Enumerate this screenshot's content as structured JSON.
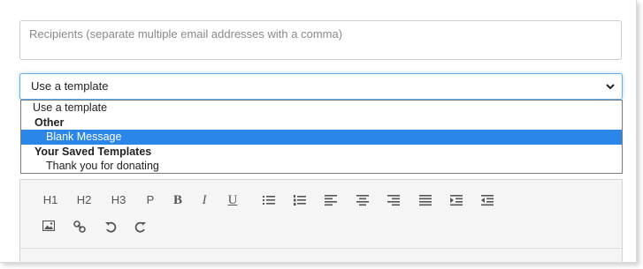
{
  "recipients": {
    "placeholder": "Recipients (separate multiple email addresses with a comma)"
  },
  "template_select": {
    "value": "Use a template",
    "options": [
      {
        "type": "option",
        "label": "Use a template"
      },
      {
        "type": "group",
        "label": "Other"
      },
      {
        "type": "option",
        "label": "Blank Message",
        "selected": true
      },
      {
        "type": "group",
        "label": "Your Saved Templates"
      },
      {
        "type": "option",
        "label": "Thank you for donating"
      }
    ]
  },
  "toolbar": {
    "h1": "H1",
    "h2": "H2",
    "h3": "H3",
    "p": "P",
    "bold": "B",
    "italic": "I",
    "underline": "U",
    "icons": [
      "bullet-list-icon",
      "numbered-list-icon",
      "align-left-icon",
      "align-center-icon",
      "align-right-icon",
      "align-justify-icon",
      "indent-icon",
      "outdent-icon",
      "image-icon",
      "link-icon",
      "undo-icon",
      "redo-icon"
    ]
  },
  "colors": {
    "accent": "#2a87e8",
    "focus_border": "#66afe9"
  }
}
